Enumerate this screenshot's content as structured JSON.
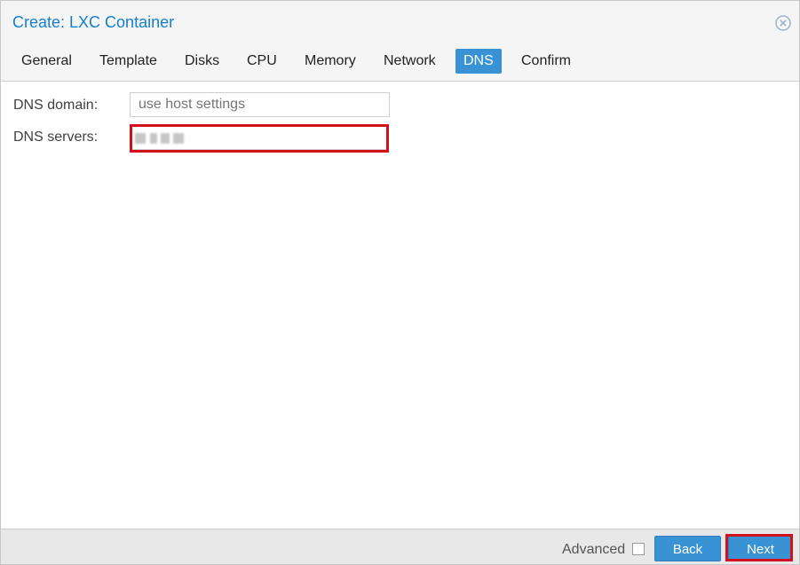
{
  "window": {
    "title": "Create: LXC Container",
    "close_icon": "close-circle-icon"
  },
  "tabs": [
    {
      "label": "General",
      "active": false
    },
    {
      "label": "Template",
      "active": false
    },
    {
      "label": "Disks",
      "active": false
    },
    {
      "label": "CPU",
      "active": false
    },
    {
      "label": "Memory",
      "active": false
    },
    {
      "label": "Network",
      "active": false
    },
    {
      "label": "DNS",
      "active": true
    },
    {
      "label": "Confirm",
      "active": false
    }
  ],
  "form": {
    "dns_domain": {
      "label": "DNS domain:",
      "value": "",
      "placeholder": "use host settings"
    },
    "dns_servers": {
      "label": "DNS servers:",
      "value": "(redacted)",
      "highlighted": true
    }
  },
  "footer": {
    "advanced_label": "Advanced",
    "advanced_checked": false,
    "back_label": "Back",
    "next_label": "Next"
  },
  "colors": {
    "accent": "#3892d4",
    "title": "#157fcc",
    "highlight": "#d0111b"
  }
}
